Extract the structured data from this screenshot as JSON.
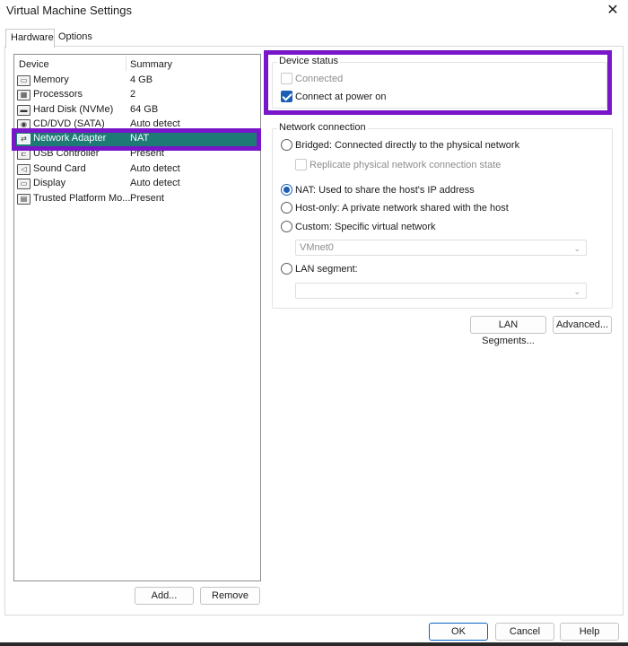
{
  "window": {
    "title": "Virtual Machine Settings",
    "close_glyph": "✕"
  },
  "tabs": [
    {
      "label": "Hardware",
      "active": true
    },
    {
      "label": "Options",
      "active": false
    }
  ],
  "device_list": {
    "headers": {
      "device": "Device",
      "summary": "Summary"
    },
    "items": [
      {
        "name": "Memory",
        "summary": "4 GB",
        "icon": "memory-icon",
        "glyph": "▭"
      },
      {
        "name": "Processors",
        "summary": "2",
        "icon": "processor-icon",
        "glyph": "▦"
      },
      {
        "name": "Hard Disk (NVMe)",
        "summary": "64 GB",
        "icon": "hard-disk-icon",
        "glyph": "▬"
      },
      {
        "name": "CD/DVD (SATA)",
        "summary": "Auto detect",
        "icon": "cd-dvd-icon",
        "glyph": "◉"
      },
      {
        "name": "Network Adapter",
        "summary": "NAT",
        "icon": "network-adapter-icon",
        "glyph": "⇄",
        "selected": true
      },
      {
        "name": "USB Controller",
        "summary": "Present",
        "icon": "usb-icon",
        "glyph": "⊏"
      },
      {
        "name": "Sound Card",
        "summary": "Auto detect",
        "icon": "speaker-icon",
        "glyph": "◁"
      },
      {
        "name": "Display",
        "summary": "Auto detect",
        "icon": "display-icon",
        "glyph": "▭"
      },
      {
        "name": "Trusted Platform Mo...",
        "summary": "Present",
        "icon": "tpm-icon",
        "glyph": "▤"
      }
    ]
  },
  "list_buttons": {
    "add": "Add...",
    "remove": "Remove"
  },
  "device_status": {
    "label": "Device status",
    "connected": {
      "label": "Connected",
      "checked": false,
      "disabled": true
    },
    "connect_at_power_on": {
      "label": "Connect at power on",
      "checked": true
    }
  },
  "network_connection": {
    "label": "Network connection",
    "bridged": {
      "prefix": "Bridged",
      "label": ": Connected directly to the physical network"
    },
    "replicate": {
      "label": "Replicate physical network connection state",
      "disabled": true
    },
    "nat": {
      "prefix": "NAT",
      "label": ": Used to share the host's IP address",
      "selected": true
    },
    "host_only": {
      "prefix": "Host-only",
      "label": ": A private network shared with the host"
    },
    "custom": {
      "prefix": "Custom",
      "label": ": Specific virtual network"
    },
    "vmnet_value": "VMnet0",
    "lan_segment": {
      "prefix": "LAN segment",
      "label": ":"
    },
    "lan_segment_value": ""
  },
  "network_buttons": {
    "lan_segments": "LAN Segments...",
    "advanced": "Advanced..."
  },
  "dialog_buttons": {
    "ok": "OK",
    "cancel": "Cancel",
    "help": "Help"
  },
  "colors": {
    "selection": "#1d7a75",
    "highlight": "#7a16c9",
    "accent": "#1a5fb4"
  }
}
